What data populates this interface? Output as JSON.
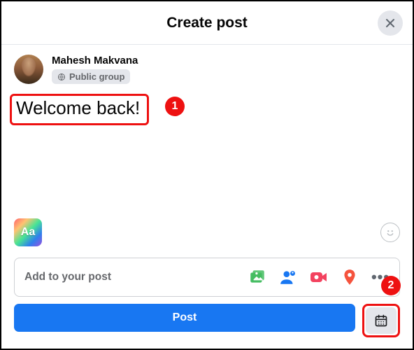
{
  "header": {
    "title": "Create post"
  },
  "user": {
    "name": "Mahesh Makvana",
    "audience": "Public group"
  },
  "post": {
    "text": "Welcome back!"
  },
  "background_button": {
    "label": "Aa"
  },
  "add_bar": {
    "label": "Add to your post"
  },
  "buttons": {
    "post": "Post"
  },
  "callouts": {
    "one": "1",
    "two": "2"
  },
  "colors": {
    "primary": "#1877f2",
    "highlight": "#e11",
    "photo_icon": "#45bd62",
    "tag_icon": "#1877f2",
    "live_icon": "#f3425f",
    "location_icon": "#f5533d"
  }
}
